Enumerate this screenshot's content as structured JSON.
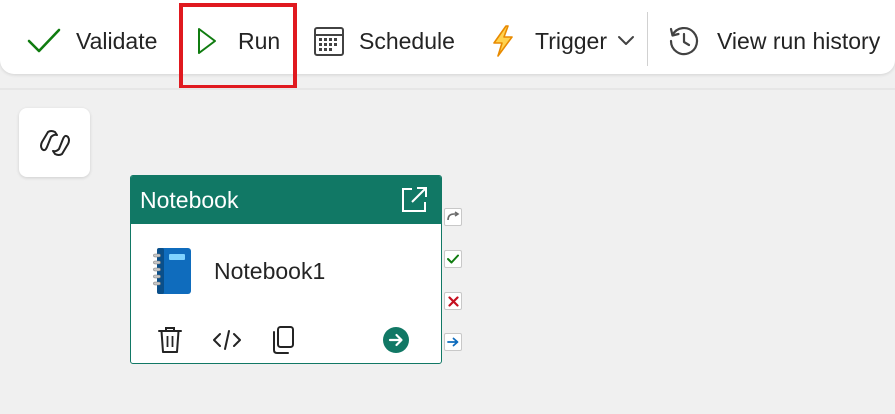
{
  "toolbar": {
    "validate_label": "Validate",
    "run_label": "Run",
    "schedule_label": "Schedule",
    "trigger_label": "Trigger",
    "history_label": "View run history"
  },
  "activity": {
    "type_label": "Notebook",
    "name": "Notebook1"
  },
  "colors": {
    "accent_green": "#117865",
    "validate_check": "#107c10",
    "run_play": "#107c10",
    "trigger_bolt": "#f7a000",
    "highlight_red": "#e0191f",
    "notebook_blue": "#0f6cbd"
  },
  "icons": [
    "check-icon",
    "play-icon",
    "calendar-icon",
    "lightning-icon",
    "chevron-down-icon",
    "history-icon",
    "copilot-icon",
    "open-external-icon",
    "notebook-icon",
    "trash-icon",
    "code-icon",
    "copy-icon",
    "arrow-right-circle-icon",
    "skip-icon",
    "success-check-icon",
    "fail-x-icon",
    "completion-arrow-icon"
  ]
}
